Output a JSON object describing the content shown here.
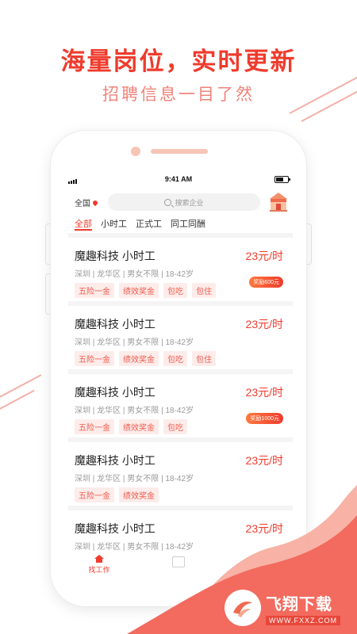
{
  "banner": {
    "headline": "海量岗位，实时更新",
    "subheadline": "招聘信息一目了然"
  },
  "status_bar": {
    "time": "9:41 AM"
  },
  "header": {
    "location": "全国",
    "search_placeholder": "搜索企业"
  },
  "tabs": [
    {
      "label": "全部",
      "active": true
    },
    {
      "label": "小时工",
      "active": false
    },
    {
      "label": "正式工",
      "active": false
    },
    {
      "label": "同工同酬",
      "active": false
    }
  ],
  "jobs": [
    {
      "title": "魔趣科技 小时工",
      "salary": "23元/时",
      "meta": "深圳 | 龙华区 | 男女不限 | 18-42岁",
      "tags": [
        "五险一金",
        "绩效奖金",
        "包吃",
        "包住"
      ],
      "bonus": "奖励600元"
    },
    {
      "title": "魔趣科技 小时工",
      "salary": "23元/时",
      "meta": "深圳 | 龙华区 | 男女不限 | 18-42岁",
      "tags": [
        "五险一金",
        "绩效奖金",
        "包吃",
        "包住"
      ]
    },
    {
      "title": "魔趣科技 小时工",
      "salary": "23元/时",
      "meta": "深圳 | 龙华区 | 男女不限 | 18-42岁",
      "tags": [
        "五险一金",
        "绩效奖金",
        "包吃"
      ],
      "bonus": "奖励1000元"
    },
    {
      "title": "魔趣科技 小时工",
      "salary": "23元/时",
      "meta": "深圳 | 龙华区 | 男女不限 | 18-42岁",
      "tags": [
        "五险一金",
        "绩效奖金"
      ]
    },
    {
      "title": "魔趣科技 小时工",
      "salary": "23元/时",
      "meta": "深圳 | 龙华区 | 男女不限 | 18-42岁",
      "tags": []
    }
  ],
  "bottom_nav": {
    "home_label": "找工作"
  },
  "watermark": {
    "name": "飞翔下载",
    "url": "WWW.FXXZ.COM"
  },
  "colors": {
    "accent": "#ef3b2d",
    "tag_bg": "#fdecea",
    "wave": "#f26b5e"
  },
  "icons": [
    "location-pin-icon",
    "search-icon",
    "shop-icon",
    "home-icon",
    "signal-icon",
    "battery-icon"
  ]
}
